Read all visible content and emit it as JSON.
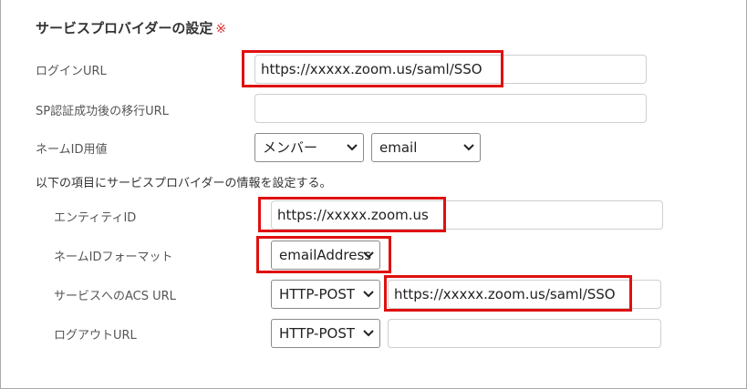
{
  "section": {
    "title": "サービスプロバイダーの設定",
    "required_mark": "※"
  },
  "fields": {
    "login_url": {
      "label": "ログインURL",
      "value": "https://xxxxx.zoom.us/saml/SSO"
    },
    "sp_redirect_url": {
      "label": "SP認証成功後の移行URL",
      "value": ""
    },
    "name_id_value": {
      "label": "ネームID用値",
      "select1": "メンバー",
      "select2": "email"
    }
  },
  "note": "以下の項目にサービスプロバイダーの情報を設定する。",
  "sp_info": {
    "entity_id": {
      "label": "エンティティID",
      "value": "https://xxxxx.zoom.us"
    },
    "name_id_format": {
      "label": "ネームIDフォーマット",
      "value": "emailAddress"
    },
    "acs_url": {
      "label": "サービスへのACS URL",
      "binding": "HTTP-POST",
      "value": "https://xxxxx.zoom.us/saml/SSO"
    },
    "logout_url": {
      "label": "ログアウトURL",
      "binding": "HTTP-POST",
      "value": ""
    }
  },
  "colors": {
    "highlight": "#e01010",
    "required": "#e03030"
  }
}
